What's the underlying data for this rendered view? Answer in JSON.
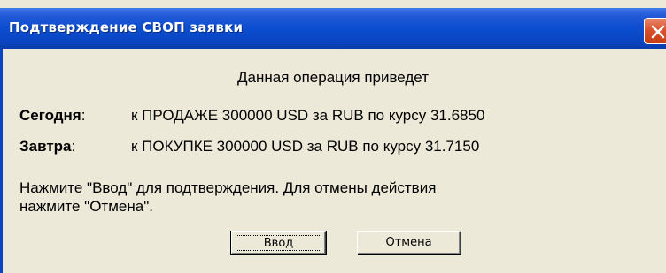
{
  "window": {
    "title": "Подтверждение СВОП заявки"
  },
  "message": {
    "intro": "Данная операция приведет",
    "today_label": "Сегодня",
    "today_colon": ":",
    "today_text": "к ПРОДАЖЕ 300000 USD за RUB по курсу 31.6850",
    "tomorrow_label": "Завтра",
    "tomorrow_colon": ":",
    "tomorrow_text": "к ПОКУПКЕ 300000 USD за RUB по курсу 31.7150",
    "confirm_line1": "Нажмите \"Ввод\" для подтверждения. Для отмены действия",
    "confirm_line2": "нажмите \"Отмена\"."
  },
  "buttons": {
    "ok_label": "Ввод",
    "cancel_label": "Отмена"
  },
  "icons": {
    "close": "close-icon"
  },
  "colors": {
    "titlebar": "#0a46c4",
    "close_button": "#d9522c",
    "dialog_background": "#ece9d8"
  }
}
